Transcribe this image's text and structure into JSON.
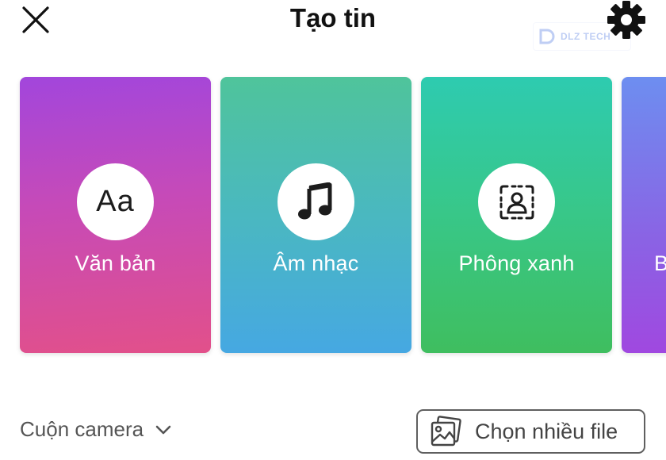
{
  "header": {
    "title": "Tạo tin",
    "close_icon": "close-icon",
    "settings_icon": "gear-icon"
  },
  "watermark": {
    "text": "DLZ TECH"
  },
  "cards": [
    {
      "label": "Văn bản",
      "icon": "text-aa-icon",
      "glyph": "Aa"
    },
    {
      "label": "Âm nhạc",
      "icon": "music-note-icon"
    },
    {
      "label": "Phông xanh",
      "icon": "green-screen-icon"
    },
    {
      "label": "B",
      "icon": "boomerang-icon"
    }
  ],
  "bottom": {
    "camera_roll_label": "Cuộn camera",
    "dropdown_icon": "chevron-down-icon",
    "select_multiple_label": "Chọn nhiều file",
    "select_multiple_icon": "gallery-icon"
  },
  "colors": {
    "card_text": "#c64ab8",
    "card_music": "#4ab8c0",
    "card_green": "#38c788",
    "card_boom": "#8b62e4"
  }
}
